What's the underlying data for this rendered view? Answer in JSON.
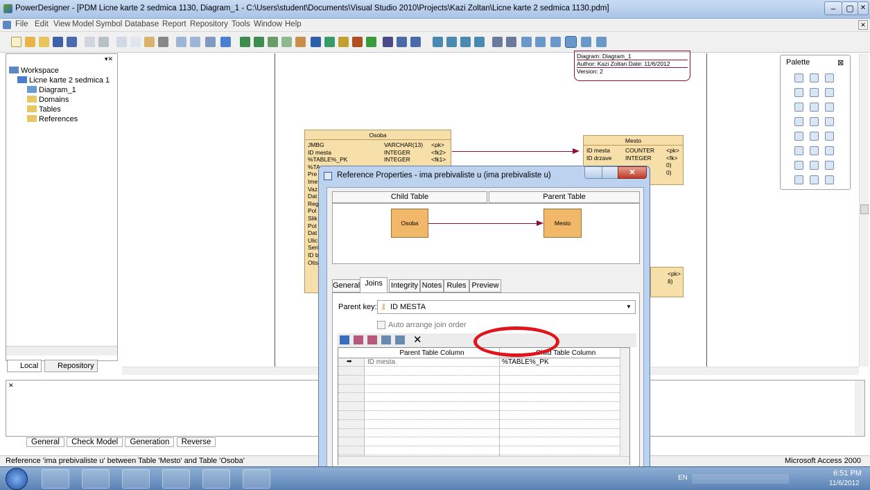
{
  "window": {
    "title": "PowerDesigner - [PDM Licne karte 2 sedmica 1130, Diagram_1 - C:\\Users\\student\\Documents\\Visual Studio 2010\\Projects\\Kazi Zoltan\\Licne karte 2 sedmica 1130.pdm]",
    "min": "–",
    "max": "▢",
    "close": "✕",
    "mdi_close": "✕"
  },
  "menu": [
    "File",
    "Edit",
    "View",
    "Model",
    "Symbol",
    "Database",
    "Report",
    "Repository",
    "Tools",
    "Window",
    "Help"
  ],
  "tree": {
    "workspace": "Workspace",
    "model": "Licne karte 2 sedmica 1",
    "children": [
      "Diagram_1",
      "Domains",
      "Tables",
      "References"
    ],
    "tabs": [
      "Local",
      "Repository"
    ]
  },
  "canvas": {
    "diagram_info": [
      "Diagram: Diagram_1",
      "Author: Kazi Zoltan   Date: 11/6/2012",
      "Version: 2"
    ],
    "osoba": {
      "title": "Osoba",
      "rows": [
        [
          "JMBG",
          "VARCHAR(13)",
          "<pk>"
        ],
        [
          "ID mesta",
          "INTEGER",
          "<fk2>"
        ],
        [
          "%TABLE%_PK",
          "INTEGER",
          "<fk1>"
        ],
        [
          "%TA",
          "",
          ""
        ],
        [
          "Pre",
          "",
          ""
        ],
        [
          "Ime",
          "",
          ""
        ],
        [
          "Vaz",
          "",
          ""
        ],
        [
          "Dat",
          "",
          ""
        ],
        [
          "Reg",
          "",
          ""
        ],
        [
          "Pol",
          "",
          ""
        ],
        [
          "Slik",
          "",
          ""
        ],
        [
          "Pot",
          "",
          ""
        ],
        [
          "Dat",
          "",
          ""
        ],
        [
          "Ulic",
          "",
          ""
        ],
        [
          "Seri",
          "",
          ""
        ],
        [
          "ID b",
          "",
          ""
        ],
        [
          "Otis",
          "",
          ""
        ]
      ]
    },
    "mesto": {
      "title": "Mesto",
      "rows": [
        [
          "ID mesta",
          "COUNTER",
          "<pk>"
        ],
        [
          "ID drzave",
          "INTEGER",
          "<fk>"
        ],
        [
          "",
          "",
          "0)"
        ],
        [
          "",
          "",
          "0)"
        ]
      ]
    },
    "third_entity": {
      "rows": [
        [
          "",
          "",
          "<pk>"
        ],
        [
          "",
          "",
          "8)"
        ]
      ]
    }
  },
  "palette": {
    "title": "Palette",
    "close": "⊠"
  },
  "dialog": {
    "title": "Reference Properties - ima prebivaliste u (ima prebivaliste u)",
    "child_table_label": "Child Table",
    "parent_table_label": "Parent Table",
    "child_entity": "Osoba",
    "parent_entity": "Mesto",
    "tabs": [
      "General",
      "Joins",
      "Integrity",
      "Notes",
      "Rules",
      "Preview"
    ],
    "active_tab": "Joins",
    "parent_key_label": "Parent key:",
    "parent_key_value": "ID MESTA",
    "auto_arrange": "Auto arrange join order",
    "grid_headers": [
      "Parent Table Column",
      "Child Table Column"
    ],
    "grid_rows": [
      [
        "ID mesta",
        "%TABLE%_PK"
      ]
    ]
  },
  "output_tabs": [
    "General",
    "Check Model",
    "Generation",
    "Reverse"
  ],
  "status": {
    "left": "Reference 'ima prebivaliste u' between Table 'Mesto' and Table 'Osoba'",
    "right": "Microsoft Access 2000"
  },
  "taskbar": {
    "lang": "EN",
    "time": "6:51 PM",
    "date": "11/6/2012"
  },
  "colors": {
    "accent_red": "#e0141c",
    "entity_fill": "#f6dfa9",
    "entity_box": "#f2b86a",
    "link": "#8a1040"
  }
}
